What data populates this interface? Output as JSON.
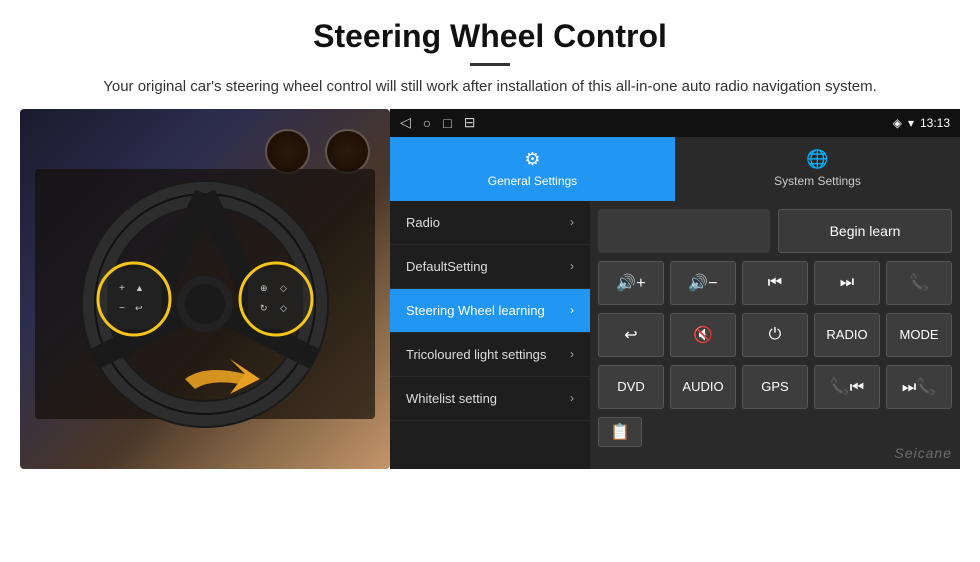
{
  "header": {
    "title": "Steering Wheel Control",
    "subtitle": "Your original car's steering wheel control will still work after installation of this all-in-one auto radio navigation system."
  },
  "android_ui": {
    "status_bar": {
      "nav_icons": [
        "◁",
        "○",
        "□",
        "⊟"
      ],
      "location_icon": "♦",
      "wifi_icon": "▾",
      "time": "13:13"
    },
    "tabs": [
      {
        "id": "general",
        "label": "General Settings",
        "active": true
      },
      {
        "id": "system",
        "label": "System Settings",
        "active": false
      }
    ],
    "menu_items": [
      {
        "id": "radio",
        "label": "Radio",
        "active": false
      },
      {
        "id": "default_setting",
        "label": "DefaultSetting",
        "active": false
      },
      {
        "id": "steering_wheel",
        "label": "Steering Wheel learning",
        "active": true
      },
      {
        "id": "tricoloured",
        "label": "Tricoloured light settings",
        "active": false
      },
      {
        "id": "whitelist",
        "label": "Whitelist setting",
        "active": false
      }
    ],
    "right_panel": {
      "begin_learn_label": "Begin learn",
      "button_rows": [
        [
          "🔊+",
          "🔊−",
          "⏮",
          "⏭",
          "📞"
        ],
        [
          "↩",
          "🔇×",
          "⏻",
          "RADIO",
          "MODE"
        ],
        [
          "DVD",
          "AUDIO",
          "GPS",
          "📞⏮",
          "⏭📞"
        ]
      ]
    }
  }
}
